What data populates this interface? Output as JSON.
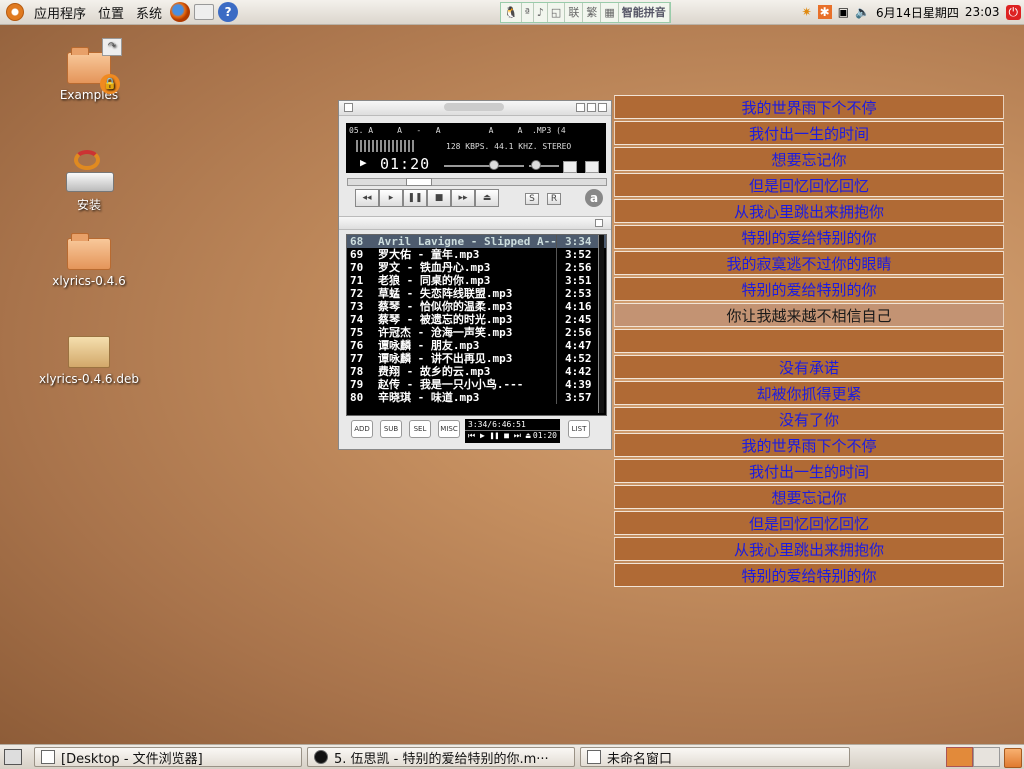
{
  "top_panel": {
    "menus": [
      "应用程序",
      "位置",
      "系统"
    ],
    "ime": {
      "items": [
        "智能拼音"
      ]
    },
    "tray": {
      "datetime": "6月14日星期四",
      "time": "23:03"
    }
  },
  "desktop_icons": [
    {
      "label": "Examples",
      "kind": "folder"
    },
    {
      "label": "安装",
      "kind": "installer"
    },
    {
      "label": "xlyrics-0.4.6",
      "kind": "folder"
    },
    {
      "label": "xlyrics-0.4.6.deb",
      "kind": "package"
    }
  ],
  "player": {
    "track_line": "05. A     A   -   A          A     A  .MP3 (4",
    "bitrate_line": "128 KBPS. 44.1 KHZ. STEREO",
    "time": "01:20",
    "buttons": [
      "ADD",
      "SUB",
      "SEL",
      "MISC",
      "LIST"
    ],
    "total_time": "3:34/6:46:51",
    "mini_time": "01:20",
    "playlist": [
      {
        "n": "68",
        "title": "Avril Lavigne - Slipped A---",
        "dur": "3:34",
        "selected": true
      },
      {
        "n": "69",
        "title": "罗大佑 - 童年.mp3",
        "dur": "3:52"
      },
      {
        "n": "70",
        "title": "罗文 - 铁血丹心.mp3",
        "dur": "2:56"
      },
      {
        "n": "71",
        "title": "老狼 - 同桌的你.mp3",
        "dur": "3:51"
      },
      {
        "n": "72",
        "title": "草蜢 - 失恋阵线联盟.mp3",
        "dur": "2:53"
      },
      {
        "n": "73",
        "title": "蔡琴 - 恰似你的温柔.mp3",
        "dur": "4:16"
      },
      {
        "n": "74",
        "title": "蔡琴 - 被遗忘的时光.mp3",
        "dur": "2:45"
      },
      {
        "n": "75",
        "title": "许冠杰 - 沧海一声笑.mp3",
        "dur": "2:56"
      },
      {
        "n": "76",
        "title": "谭咏麟 - 朋友.mp3",
        "dur": "4:47"
      },
      {
        "n": "77",
        "title": "谭咏麟 - 讲不出再见.mp3",
        "dur": "4:52"
      },
      {
        "n": "78",
        "title": "费翔 - 故乡的云.mp3",
        "dur": "4:42"
      },
      {
        "n": "79",
        "title": "赵传 - 我是一只小小鸟.---",
        "dur": "4:39"
      },
      {
        "n": "80",
        "title": "辛晓琪 - 味道.mp3",
        "dur": "3:57"
      }
    ]
  },
  "lyrics": [
    "我的世界雨下个不停",
    "我付出一生的时间",
    "想要忘记你",
    "但是回忆回忆回忆",
    "从我心里跳出来拥抱你",
    "特别的爱给特别的你",
    "我的寂寞逃不过你的眼睛",
    "特别的爱给特别的你",
    "你让我越来越不相信自己",
    "",
    "没有承诺",
    "却被你抓得更紧",
    "没有了你",
    "我的世界雨下个不停",
    "我付出一生的时间",
    "想要忘记你",
    "但是回忆回忆回忆",
    "从我心里跳出来拥抱你",
    "特别的爱给特别的你"
  ],
  "current_lyric_index": 8,
  "taskbar": [
    {
      "label": "[Desktop - 文件浏览器]"
    },
    {
      "label": "5. 伍思凯 - 特别的爱给特别的你.m···"
    },
    {
      "label": "未命名窗口"
    }
  ]
}
